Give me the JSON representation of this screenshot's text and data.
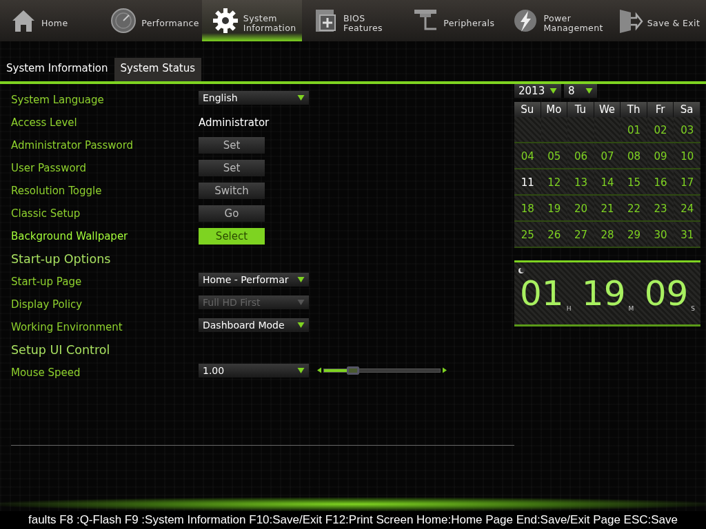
{
  "nav": [
    {
      "label": "Home",
      "selected": false
    },
    {
      "label": "Performance",
      "selected": false
    },
    {
      "label": "System\nInformation",
      "selected": true
    },
    {
      "label": "BIOS\nFeatures",
      "selected": false
    },
    {
      "label": "Peripherals",
      "selected": false
    },
    {
      "label": "Power\nManagement",
      "selected": false
    },
    {
      "label": "Save & Exit",
      "selected": false
    }
  ],
  "tabs": [
    {
      "label": "System Information",
      "selected": true
    },
    {
      "label": "System Status",
      "selected": false
    }
  ],
  "settings": [
    {
      "kind": "dropdown",
      "label": "System Language",
      "value": "English",
      "disabled": false
    },
    {
      "kind": "text",
      "label": "Access Level",
      "value": "Administrator"
    },
    {
      "kind": "button",
      "label": "Administrator Password",
      "button": "Set",
      "selected": false
    },
    {
      "kind": "button",
      "label": "User Password",
      "button": "Set",
      "selected": false
    },
    {
      "kind": "button",
      "label": "Resolution Toggle",
      "button": "Switch",
      "selected": false
    },
    {
      "kind": "button",
      "label": "Classic Setup",
      "button": "Go",
      "selected": false
    },
    {
      "kind": "button",
      "label": "Background Wallpaper",
      "button": "Select",
      "selected": true
    },
    {
      "kind": "heading",
      "label": "Start-up Options"
    },
    {
      "kind": "dropdown",
      "label": "Start-up Page",
      "value": "Home - Performar",
      "disabled": false
    },
    {
      "kind": "dropdown",
      "label": "Display Policy",
      "value": "Full HD First",
      "disabled": true
    },
    {
      "kind": "dropdown",
      "label": "Working Environment",
      "value": "Dashboard Mode",
      "disabled": false
    },
    {
      "kind": "heading",
      "label": "Setup UI Control"
    },
    {
      "kind": "slider",
      "label": "Mouse Speed",
      "value": "1.00",
      "disabled": false,
      "level": 0.25
    }
  ],
  "calendar": {
    "year": "2013",
    "month": "8",
    "weekdays": [
      "Su",
      "Mo",
      "Tu",
      "We",
      "Th",
      "Fr",
      "Sa"
    ],
    "weeks": [
      [
        {
          "day": "01",
          "selected": false
        },
        {
          "day": "02",
          "selected": false
        },
        {
          "day": "03",
          "selected": false
        }
      ],
      [
        {
          "day": "04",
          "selected": false
        },
        {
          "day": "05",
          "selected": false
        },
        {
          "day": "06",
          "selected": false
        },
        {
          "day": "07",
          "selected": false
        },
        {
          "day": "08",
          "selected": false
        },
        {
          "day": "09",
          "selected": false
        },
        {
          "day": "10",
          "selected": false
        }
      ],
      [
        {
          "day": "11",
          "selected": true
        },
        {
          "day": "12",
          "selected": false
        },
        {
          "day": "13",
          "selected": false
        },
        {
          "day": "14",
          "selected": false
        },
        {
          "day": "15",
          "selected": false
        },
        {
          "day": "16",
          "selected": false
        },
        {
          "day": "17",
          "selected": false
        }
      ],
      [
        {
          "day": "18",
          "selected": false
        },
        {
          "day": "19",
          "selected": false
        },
        {
          "day": "20",
          "selected": false
        },
        {
          "day": "21",
          "selected": false
        },
        {
          "day": "22",
          "selected": false
        },
        {
          "day": "23",
          "selected": false
        },
        {
          "day": "24",
          "selected": false
        }
      ],
      [
        {
          "day": "25",
          "selected": false
        },
        {
          "day": "26",
          "selected": false
        },
        {
          "day": "27",
          "selected": false
        },
        {
          "day": "28",
          "selected": false
        },
        {
          "day": "29",
          "selected": false
        },
        {
          "day": "30",
          "selected": false
        },
        {
          "day": "31",
          "selected": false
        }
      ]
    ]
  },
  "clock": {
    "hours": "01",
    "minutes": "19",
    "seconds": "09",
    "hours_label": "H",
    "minutes_label": "M",
    "seconds_label": "S"
  },
  "status_bar": "faults F8 :Q-Flash F9 :System Information F10:Save/Exit F12:Print Screen Home:Home Page End:Save/Exit Page ESC:Save"
}
